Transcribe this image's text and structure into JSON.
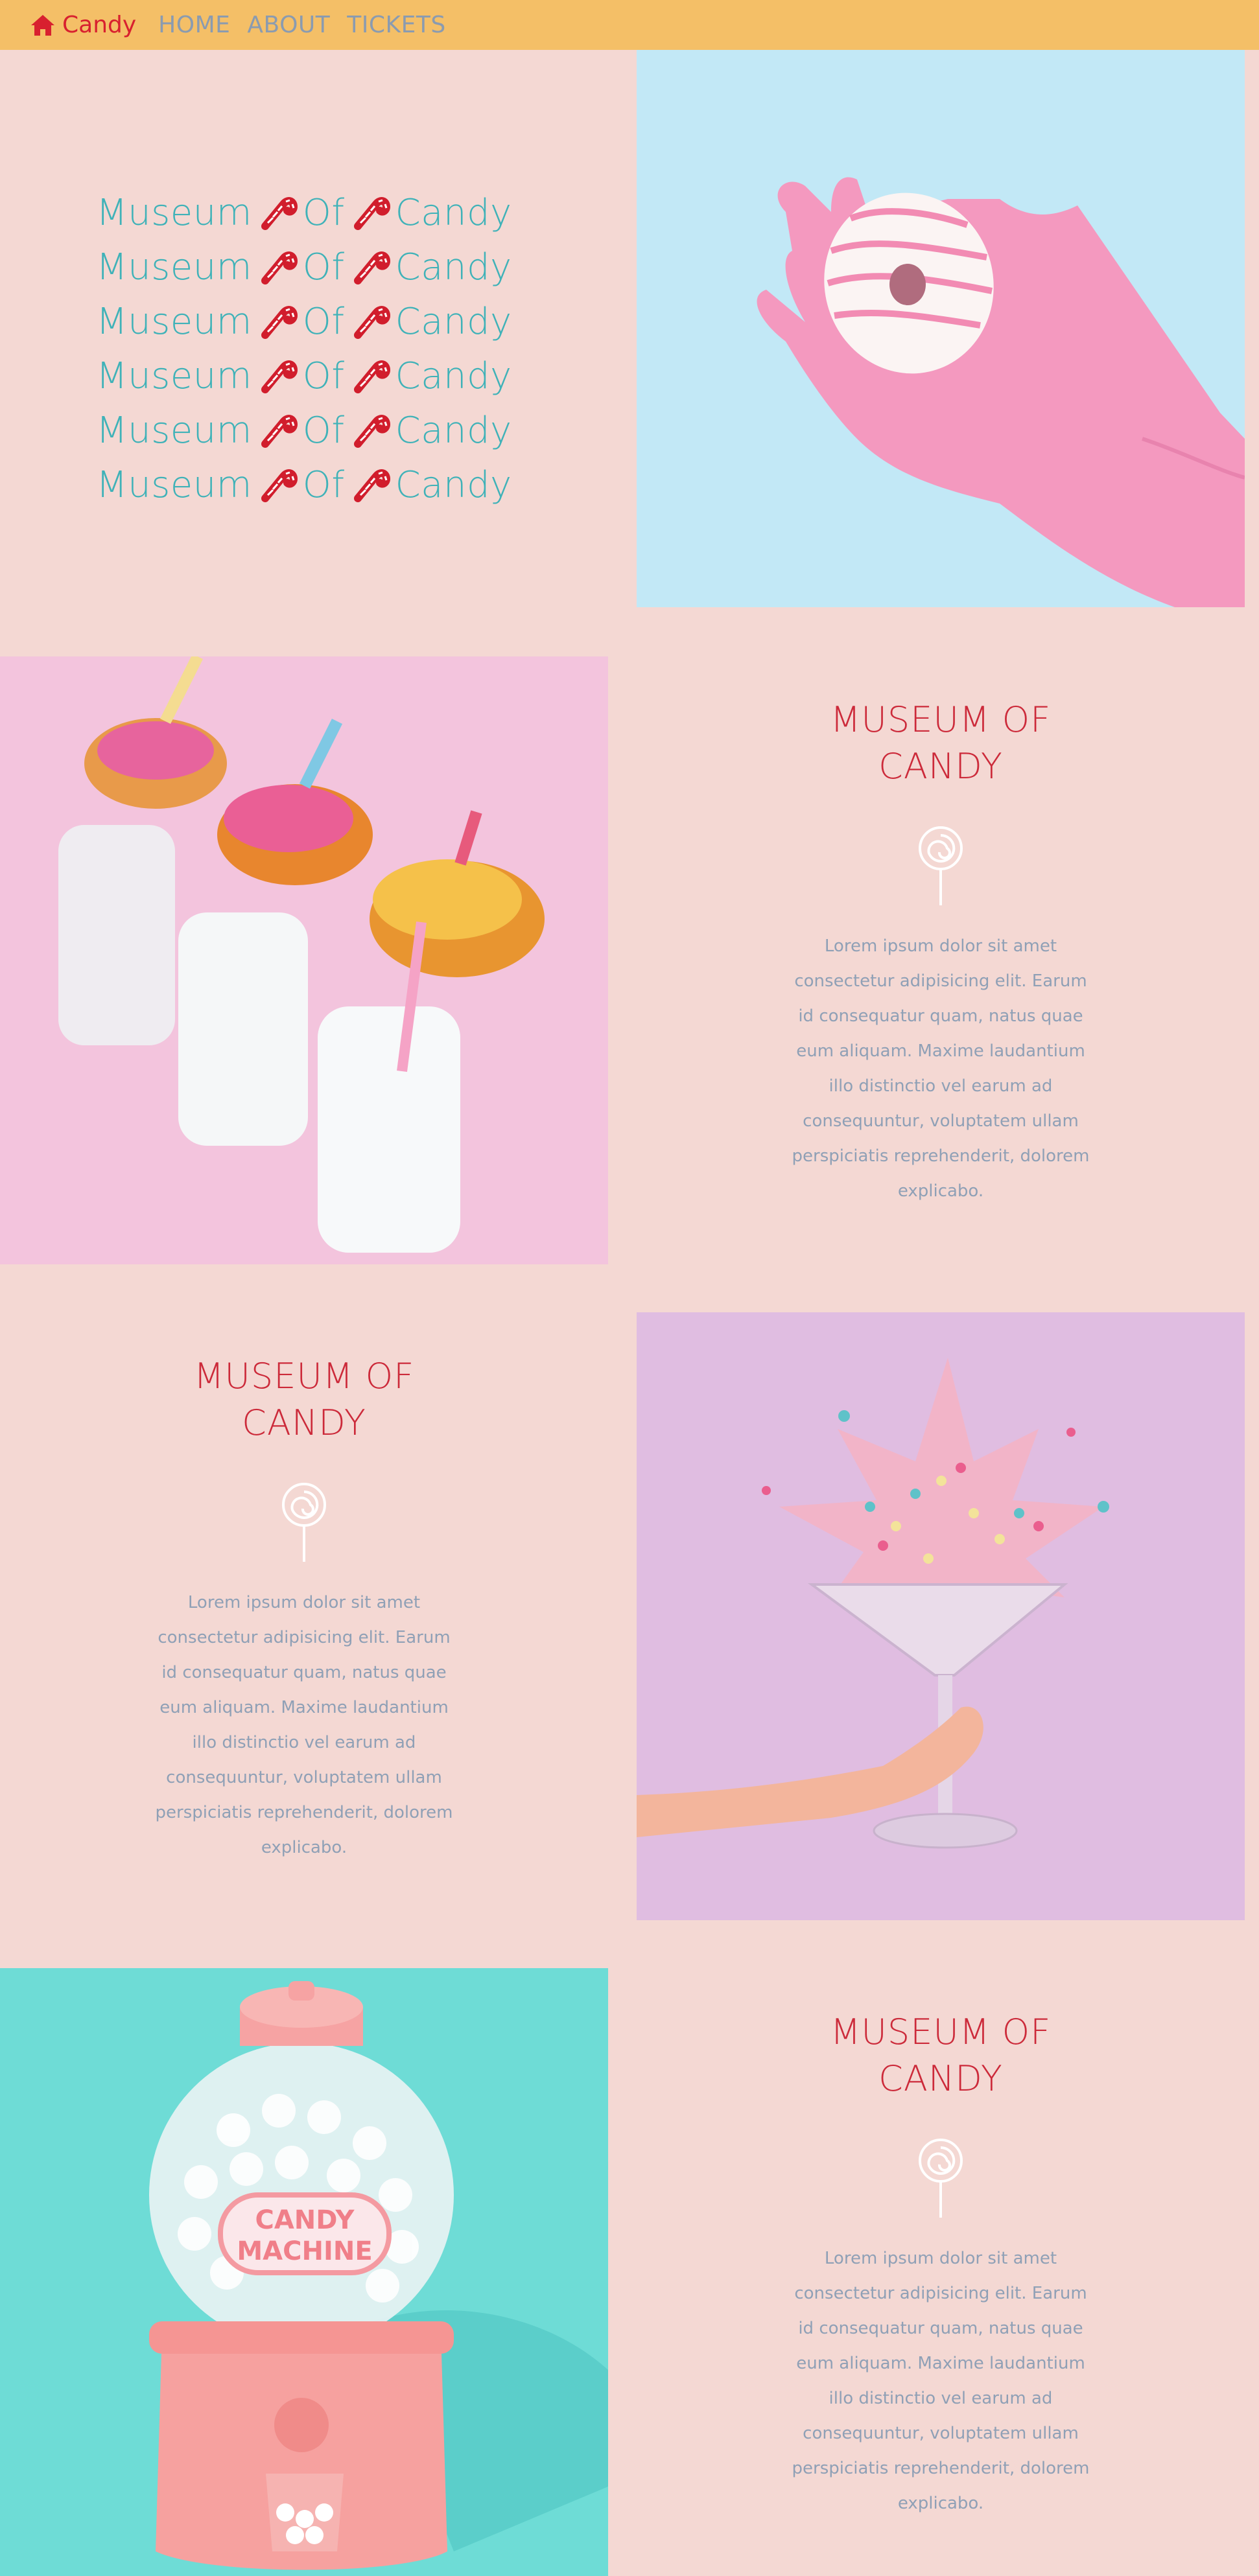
{
  "nav": {
    "brand": "Candy",
    "links": [
      "HOME",
      "ABOUT",
      "TICKETS"
    ]
  },
  "hero": {
    "word1": "Museum",
    "word2": "Of",
    "word3": "Candy",
    "repeat": 6
  },
  "sections": [
    {
      "heading": "MUSEUM OF CANDY",
      "text": "Lorem ipsum dolor sit amet consectetur adipisicing elit. Earum id consequatur quam, natus quae eum aliquam. Maxime laudantium illo distinctio vel earum ad consequuntur, voluptatem ullam perspiciatis reprehenderit, dolorem explicabo."
    },
    {
      "heading": "MUSEUM OF CANDY",
      "text": "Lorem ipsum dolor sit amet consectetur adipisicing elit. Earum id consequatur quam, natus quae eum aliquam. Maxime laudantium illo distinctio vel earum ad consequuntur, voluptatem ullam perspiciatis reprehenderit, dolorem explicabo."
    },
    {
      "heading": "MUSEUM OF CANDY",
      "text": "Lorem ipsum dolor sit amet consectetur adipisicing elit. Earum id consequatur quam, natus quae eum aliquam. Maxime laudantium illo distinctio vel earum ad consequuntur, voluptatem ullam perspiciatis reprehenderit, dolorem explicabo."
    }
  ],
  "machine_label": [
    "CANDY",
    "MACHINE"
  ],
  "colors": {
    "nav_bg": "#f4bf67",
    "page_bg": "#f4d8d3",
    "brand": "#d8202f",
    "title_teal": "#3fb2b8",
    "heading_red": "#cc2a3a",
    "body_text": "#8fa0b6"
  }
}
